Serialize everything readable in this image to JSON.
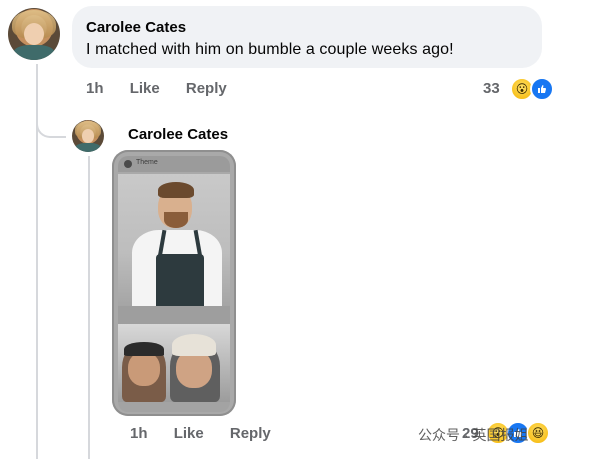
{
  "comment": {
    "author": "Carolee Cates",
    "text": "I matched with him on bumble a couple weeks ago!",
    "timestamp": "1h",
    "like_label": "Like",
    "reply_label": "Reply",
    "reaction_count": "33",
    "reactions": [
      "wow-emoji",
      "like-emoji"
    ]
  },
  "reply": {
    "author": "Carolee Cates",
    "attachment": {
      "type": "phone-screenshot",
      "app_title": "Theme"
    },
    "timestamp": "1h",
    "like_label": "Like",
    "reply_label": "Reply",
    "reaction_count": "29",
    "reactions": [
      "wow-emoji",
      "like-emoji",
      "haha-emoji"
    ]
  },
  "watermark": "公众号 · 英国报姐",
  "colors": {
    "bubble_bg": "#f0f2f5",
    "meta_text": "#65676b",
    "like_blue": "#1877f2",
    "thread_line": "#d6d8dc"
  }
}
